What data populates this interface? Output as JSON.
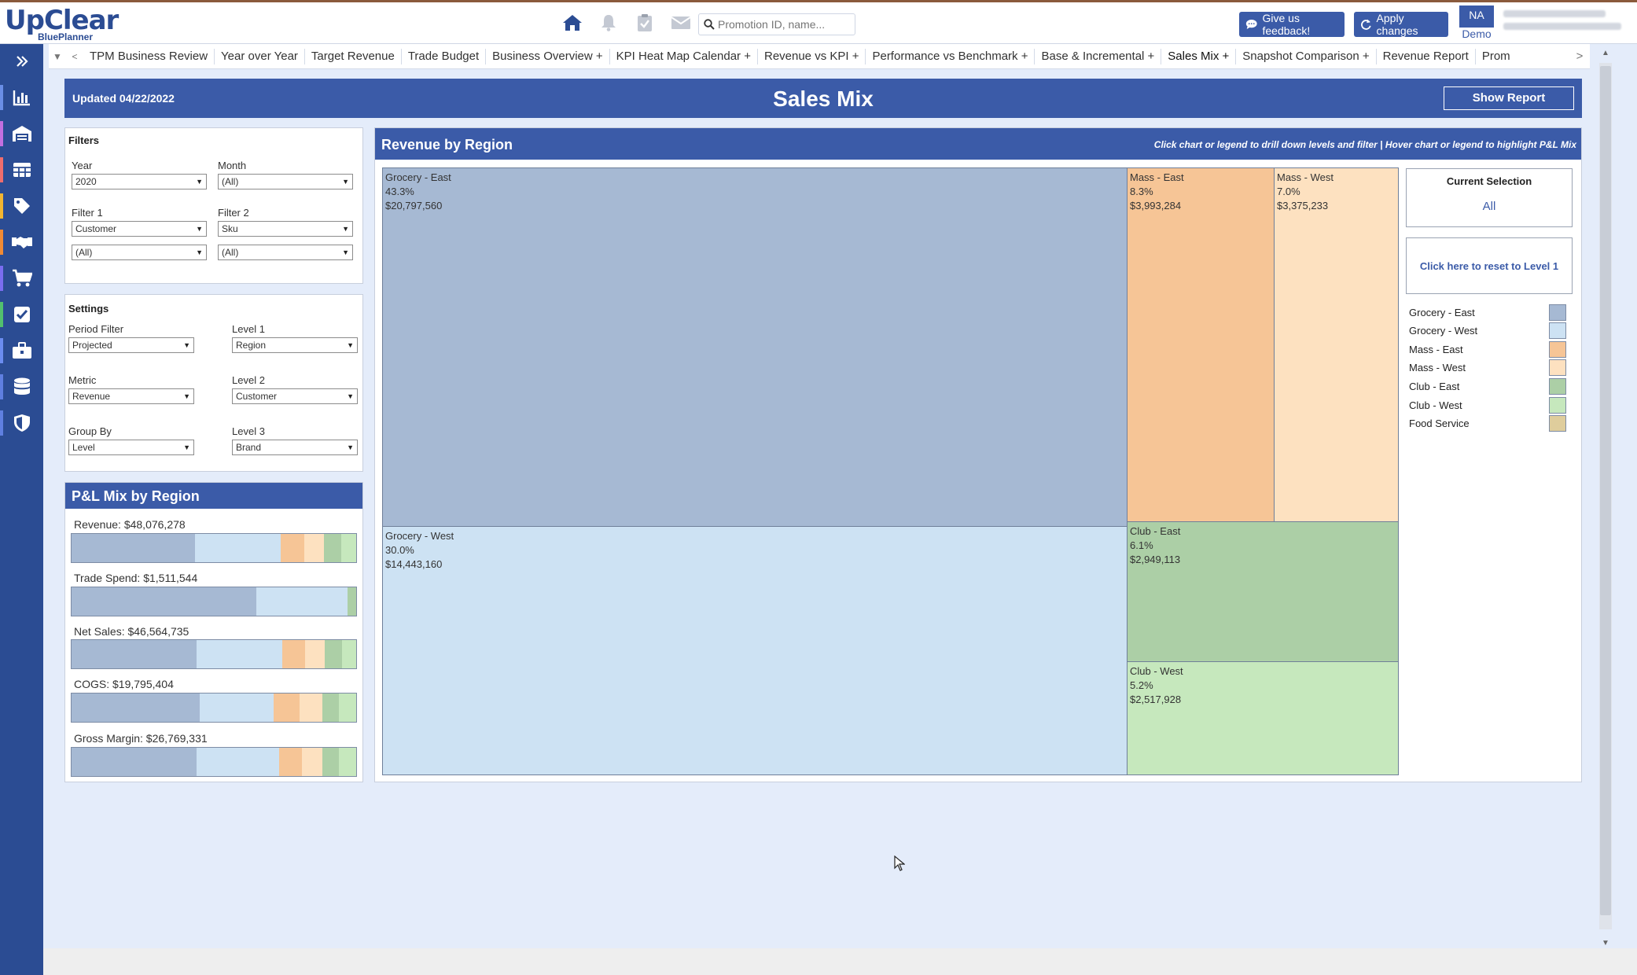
{
  "app": {
    "logo_main": "UpClear",
    "logo_sub": "BluePlanner"
  },
  "search": {
    "placeholder": "Promotion ID, name..."
  },
  "toolbar": {
    "feedback_label": "Give us feedback!",
    "apply_label": "Apply changes"
  },
  "user": {
    "initials": "NA",
    "env": "Demo"
  },
  "tabs": [
    "TPM Business Review",
    "Year over Year",
    "Target Revenue",
    "Trade Budget",
    "Business Overview +",
    "KPI Heat Map Calendar +",
    "Revenue vs KPI +",
    "Performance vs Benchmark +",
    "Base & Incremental +",
    "Sales Mix +",
    "Snapshot Comparison +",
    "Revenue Report",
    "Prom"
  ],
  "header": {
    "updated": "Updated 04/22/2022",
    "title": "Sales Mix",
    "show_report": "Show Report"
  },
  "filters": {
    "title": "Filters",
    "year_label": "Year",
    "year_value": "2020",
    "month_label": "Month",
    "month_value": "(All)",
    "filter1_label": "Filter 1",
    "filter1_value": "Customer",
    "filter1_sub": "(All)",
    "filter2_label": "Filter 2",
    "filter2_value": "Sku",
    "filter2_sub": "(All)"
  },
  "settings": {
    "title": "Settings",
    "period_label": "Period Filter",
    "period_value": "Projected",
    "level1_label": "Level 1",
    "level1_value": "Region",
    "metric_label": "Metric",
    "metric_value": "Revenue",
    "level2_label": "Level 2",
    "level2_value": "Customer",
    "groupby_label": "Group By",
    "groupby_value": "Level",
    "level3_label": "Level 3",
    "level3_value": "Brand"
  },
  "colors": {
    "grocery_east": "#a6b9d3",
    "grocery_west": "#cde2f3",
    "mass_east": "#f6c596",
    "mass_west": "#fde1c0",
    "club_east": "#accfa6",
    "club_west": "#c6e8bd",
    "food_service": "#dfcd9c",
    "brand": "#3b5ba8"
  },
  "pl_mix": {
    "title": "P&L Mix by Region",
    "rows": [
      {
        "label": "Revenue: $48,076,278",
        "shares": [
          43.3,
          30.0,
          8.3,
          7.0,
          6.1,
          5.2
        ]
      },
      {
        "label": "Trade Spend: $1,511,544",
        "shares": [
          65,
          32,
          0,
          0,
          3,
          0
        ]
      },
      {
        "label": "Net Sales: $46,564,735",
        "shares": [
          44,
          30,
          8,
          7,
          6,
          5
        ]
      },
      {
        "label": "COGS: $19,795,404",
        "shares": [
          45,
          26,
          9,
          8,
          6,
          6
        ]
      },
      {
        "label": "Gross Margin: $26,769,331",
        "shares": [
          44,
          29,
          8,
          7,
          6,
          6
        ]
      }
    ]
  },
  "treemap": {
    "title": "Revenue by Region",
    "hint": "Click chart or legend to drill down levels and filter | Hover chart or legend to highlight P&L Mix",
    "cells": [
      {
        "name": "Grocery - East",
        "pct": "43.3%",
        "value": "$20,797,560"
      },
      {
        "name": "Grocery - West",
        "pct": "30.0%",
        "value": "$14,443,160"
      },
      {
        "name": "Mass - East",
        "pct": "8.3%",
        "value": "$3,993,284"
      },
      {
        "name": "Mass - West",
        "pct": "7.0%",
        "value": "$3,375,233"
      },
      {
        "name": "Club - East",
        "pct": "6.1%",
        "value": "$2,949,113"
      },
      {
        "name": "Club - West",
        "pct": "5.2%",
        "value": "$2,517,928"
      }
    ]
  },
  "selection": {
    "title": "Current Selection",
    "value": "All",
    "reset": "Click here to reset to Level 1"
  },
  "legend": [
    "Grocery - East",
    "Grocery - West",
    "Mass - East",
    "Mass - West",
    "Club - East",
    "Club - West",
    "Food Service"
  ]
}
